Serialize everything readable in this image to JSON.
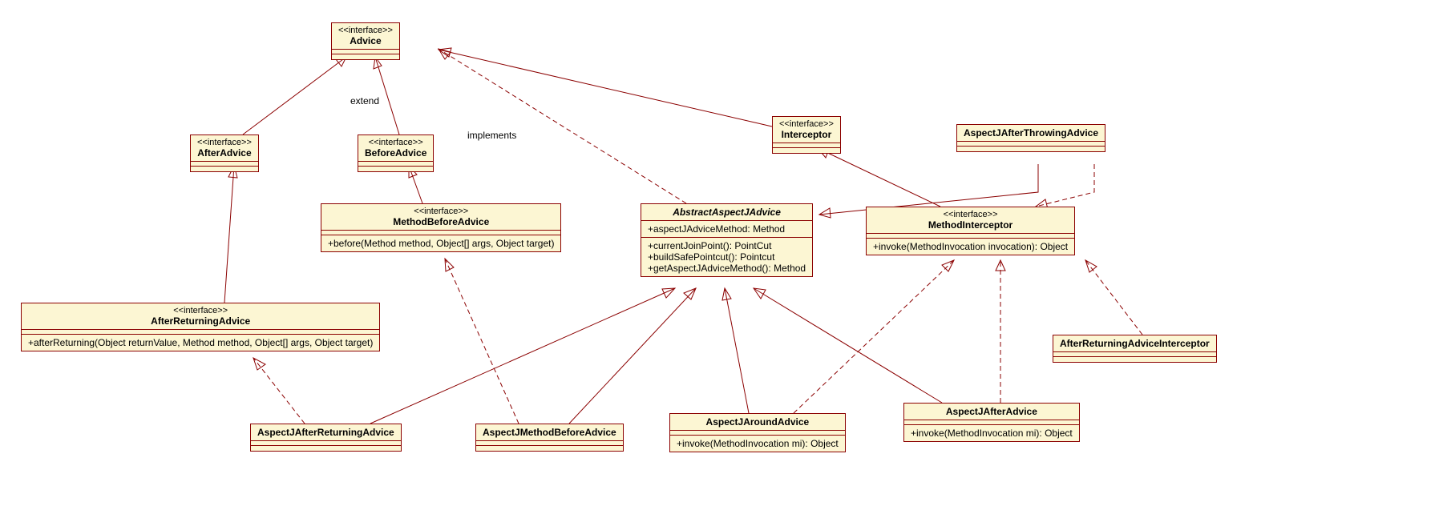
{
  "classes": {
    "advice": {
      "stereotype": "<<interface>>",
      "name": "Advice"
    },
    "afterAdvice": {
      "stereotype": "<<interface>>",
      "name": "AfterAdvice"
    },
    "beforeAdvice": {
      "stereotype": "<<interface>>",
      "name": "BeforeAdvice"
    },
    "interceptor": {
      "stereotype": "<<interface>>",
      "name": "Interceptor"
    },
    "aspectJAfterThrowing": {
      "name": "AspectJAfterThrowingAdvice"
    },
    "methodBeforeAdvice": {
      "stereotype": "<<interface>>",
      "name": "MethodBeforeAdvice",
      "methods": [
        "+before(Method method, Object[] args, Object target)"
      ]
    },
    "abstractAspectJ": {
      "name": "AbstractAspectJAdvice",
      "attributes": [
        "+aspectJAdviceMethod: Method"
      ],
      "methods": [
        "+currentJoinPoint(): PointCut",
        "+buildSafePointcut(): Pointcut",
        "+getAspectJAdviceMethod(): Method"
      ]
    },
    "methodInterceptor": {
      "stereotype": "<<interface>>",
      "name": "MethodInterceptor",
      "methods": [
        "+invoke(MethodInvocation invocation): Object"
      ]
    },
    "afterReturningAdvice": {
      "stereotype": "<<interface>>",
      "name": "AfterReturningAdvice",
      "methods": [
        "+afterReturning(Object returnValue, Method method, Object[] args, Object target)"
      ]
    },
    "afterReturningInterceptor": {
      "name": "AfterReturningAdviceInterceptor"
    },
    "aspectJAfterReturning": {
      "name": "AspectJAfterReturningAdvice"
    },
    "aspectJMethodBefore": {
      "name": "AspectJMethodBeforeAdvice"
    },
    "aspectJAround": {
      "name": "AspectJAroundAdvice",
      "methods": [
        "+invoke(MethodInvocation mi): Object"
      ]
    },
    "aspectJAfter": {
      "name": "AspectJAfterAdvice",
      "methods": [
        "+invoke(MethodInvocation mi): Object"
      ]
    }
  },
  "labels": {
    "extend": "extend",
    "implements": "implements"
  }
}
